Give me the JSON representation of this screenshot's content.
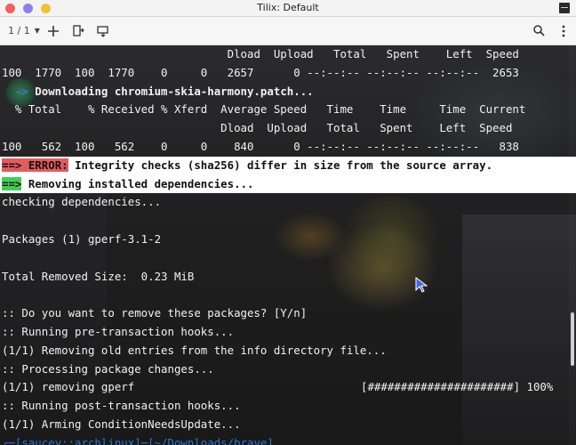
{
  "window": {
    "title": "Tilix: Default",
    "controls": [
      {
        "name": "close",
        "color": "#f4605c"
      },
      {
        "name": "minimize",
        "color": "#8a80f0"
      },
      {
        "name": "maximize",
        "color": "#f5c132"
      }
    ]
  },
  "toolbar": {
    "session_label": "1 / 1",
    "icons": [
      "chevron-down-icon",
      "add-terminal-icon",
      "split-right-icon",
      "split-down-icon",
      "search-icon",
      "menu-icon"
    ]
  },
  "terminal": {
    "line_01": "                                  Dload  Upload   Total   Spent    Left  Speed",
    "line_02": "100  1770  100  1770    0     0   2657      0 --:--:-- --:--:-- --:--:--  2653",
    "line_03_arrow": "  ->",
    "line_03_text": " Downloading chromium-skia-harmony.patch...",
    "line_04": "  % Total    % Received % Xferd  Average Speed   Time    Time     Time  Current",
    "line_05": "                                 Dload  Upload   Total   Spent    Left  Speed",
    "line_06": "100   562  100   562    0     0    840      0 --:--:-- --:--:-- --:--:--   838",
    "line_07_arrow": "==>",
    "line_07_label": " ERROR:",
    "line_07_text": " Integrity checks (sha256) differ in size from the source array.",
    "line_08_arrow": "==>",
    "line_08_text": " Removing installed dependencies...",
    "line_09": "checking dependencies...",
    "line_10": "",
    "line_11": "Packages (1) gperf-3.1-2",
    "line_12": "",
    "line_13": "Total Removed Size:  0.23 MiB",
    "line_14": "",
    "line_15": ":: Do you want to remove these packages? [Y/n]",
    "line_16": ":: Running pre-transaction hooks...",
    "line_17": "(1/1) Removing old entries from the info directory file...",
    "line_18": ":: Processing package changes...",
    "line_19": "(1/1) removing gperf",
    "line_19_progress": "[######################] 100%",
    "line_20": ":: Running post-transaction hooks...",
    "line_21": "(1/1) Arming ConditionNeedsUpdate...",
    "line_22": "┌─[saucey::archlinux]─[~/Downloads/brave]"
  },
  "colors": {
    "error": "#e35b5b",
    "success": "#3fcf55",
    "arrow_blue": "#3a7bd5"
  }
}
